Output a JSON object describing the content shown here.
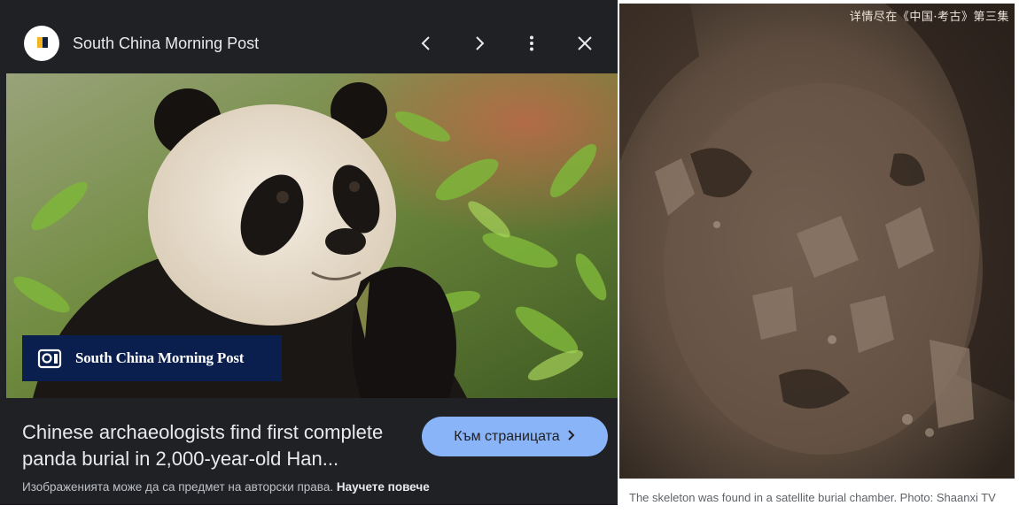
{
  "viewer": {
    "site_name": "South China Morning Post",
    "badge_text": "South China Morning Post",
    "headline": "Chinese archaeologists find first complete panda burial in 2,000-year-old Han...",
    "visit_button_label": "Към страницата",
    "copyright_text": "Изображенията може да са предмет на авторски права.",
    "learn_more_label": "Научете повече",
    "icons": [
      "site-logo-icon",
      "back-icon",
      "forward-icon",
      "more-vert-icon",
      "close-icon",
      "lens-icon",
      "chevron-right-icon"
    ],
    "colors": {
      "background": "#202124",
      "button": "#8ab4f8",
      "badge": "#0a1f4e"
    }
  },
  "article": {
    "watermark": "详情尽在《中国·考古》第三集",
    "caption": "The skeleton was found in a satellite burial chamber. Photo: Shaanxi TV"
  }
}
